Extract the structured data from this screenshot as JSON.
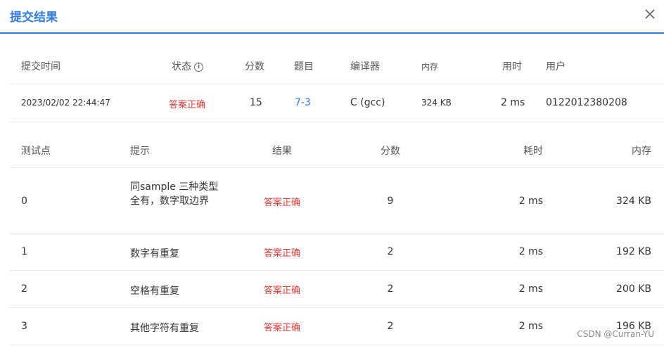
{
  "dialog": {
    "title": "提交结果"
  },
  "summary": {
    "headers": {
      "time": "提交时间",
      "status": "状态",
      "score": "分数",
      "problem": "题目",
      "compiler": "编译器",
      "memory": "内存",
      "duration": "用时",
      "user": "用户"
    },
    "row": {
      "time": "2023/02/02 22:44:47",
      "status": "答案正确",
      "score": "15",
      "problem": "7-3",
      "compiler": "C (gcc)",
      "memory": "324 KB",
      "duration": "2 ms",
      "user": "0122012380208"
    }
  },
  "tests": {
    "headers": {
      "id": "测试点",
      "hint": "提示",
      "result": "结果",
      "score": "分数",
      "duration": "耗时",
      "memory": "内存"
    },
    "rows": [
      {
        "id": "0",
        "hint": "同sample 三种类型全有，数字取边界",
        "result": "答案正确",
        "score": "9",
        "duration": "2 ms",
        "memory": "324 KB"
      },
      {
        "id": "1",
        "hint": "数字有重复",
        "result": "答案正确",
        "score": "2",
        "duration": "2 ms",
        "memory": "192 KB"
      },
      {
        "id": "2",
        "hint": "空格有重复",
        "result": "答案正确",
        "score": "2",
        "duration": "2 ms",
        "memory": "200 KB"
      },
      {
        "id": "3",
        "hint": "其他字符有重复",
        "result": "答案正确",
        "score": "2",
        "duration": "2 ms",
        "memory": "196 KB"
      }
    ]
  },
  "watermark": "CSDN @Curran-YU",
  "colors": {
    "accent": "#2f7ed8",
    "success_text": "#e53935"
  }
}
